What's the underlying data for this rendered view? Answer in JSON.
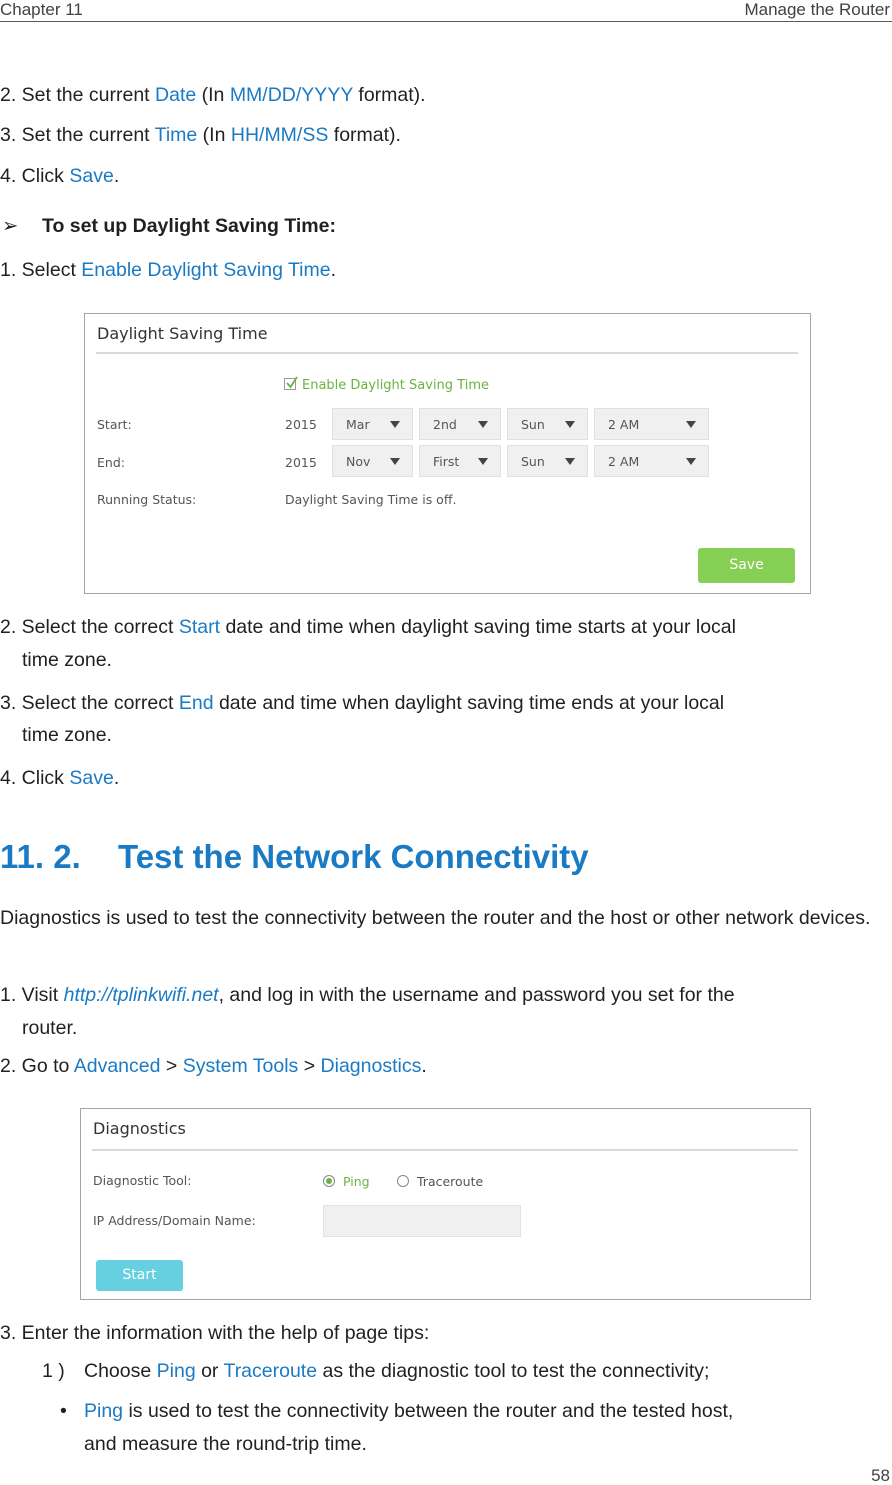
{
  "header": {
    "chapter": "Chapter 11",
    "section": "Manage the Router"
  },
  "steps_time": [
    {
      "prefix": "2. Set the current ",
      "link": "Date",
      "mid": " (In ",
      "link2": "MM/DD/YYYY",
      "suffix": " format)."
    },
    {
      "prefix": "3. Set the current ",
      "link": "Time",
      "mid": " (In ",
      "link2": "HH/MM/SS",
      "suffix": " format)."
    },
    {
      "prefix": "4. Click ",
      "link": "Save",
      "suffix": "."
    }
  ],
  "dst_heading": {
    "arrow": "➢",
    "text": "To set up Daylight Saving Time:"
  },
  "dst_step1": {
    "prefix": "1. Select ",
    "link": "Enable Daylight Saving Time",
    "suffix": "."
  },
  "dst_panel": {
    "title": "Daylight Saving Time",
    "enable_label": "Enable Daylight Saving Time",
    "enable_checked": true,
    "start_label": "Start:",
    "end_label": "End:",
    "status_label": "Running Status:",
    "status_value": "Daylight Saving Time is off.",
    "start": {
      "year": "2015",
      "month": "Mar",
      "week": "2nd",
      "day": "Sun",
      "time": "2 AM"
    },
    "end": {
      "year": "2015",
      "month": "Nov",
      "week": "First",
      "day": "Sun",
      "time": "2 AM"
    },
    "save_label": "Save",
    "save_color": "#86cf55"
  },
  "dst_steps": [
    {
      "prefix": "2. Select the correct ",
      "link": "Start",
      "suffix": " date and time when daylight saving time starts at your local time zone."
    },
    {
      "prefix": "3. Select the correct ",
      "link": "End",
      "suffix": " date and time when daylight saving time ends at your local time zone."
    },
    {
      "prefix": "4. Click ",
      "link": "Save",
      "suffix": "."
    }
  ],
  "section": {
    "number": "11. 2.",
    "title": "Test the Network Connectivity"
  },
  "intro": "Diagnostics is used to test the connectivity between the router and the host or other network devices.",
  "diag_steps": {
    "step1": {
      "prefix": "1. Visit ",
      "link": "http://tplinkwifi.net",
      "suffix": ", and log in with the username and password you set for the router."
    },
    "step2": {
      "prefix": "2. Go to ",
      "path": [
        "Advanced",
        "System Tools",
        "Diagnostics"
      ],
      "sep": " > ",
      "suffix": "."
    }
  },
  "diag_panel": {
    "title": "Diagnostics",
    "tool_label": "Diagnostic Tool:",
    "options": [
      {
        "label": "Ping",
        "selected": true
      },
      {
        "label": "Traceroute",
        "selected": false
      }
    ],
    "ip_label": "IP Address/Domain Name:",
    "ip_value": "",
    "start_label": "Start",
    "start_color": "#66cfe0"
  },
  "step3": "3. Enter the information with the help of page tips:",
  "substep1": {
    "marker": "1 )",
    "prefix": "Choose ",
    "link1": "Ping",
    "mid": " or ",
    "link2": "Traceroute",
    "suffix": " as the diagnostic tool to test the connectivity;"
  },
  "bullet1": {
    "marker": "•",
    "link": "Ping",
    "suffix": " is used to test the connectivity between the router and the tested host, and measure the round-trip time."
  },
  "page_number": "58",
  "colors": {
    "link_blue": "#1a7ac4",
    "active_green": "#6ab340"
  }
}
